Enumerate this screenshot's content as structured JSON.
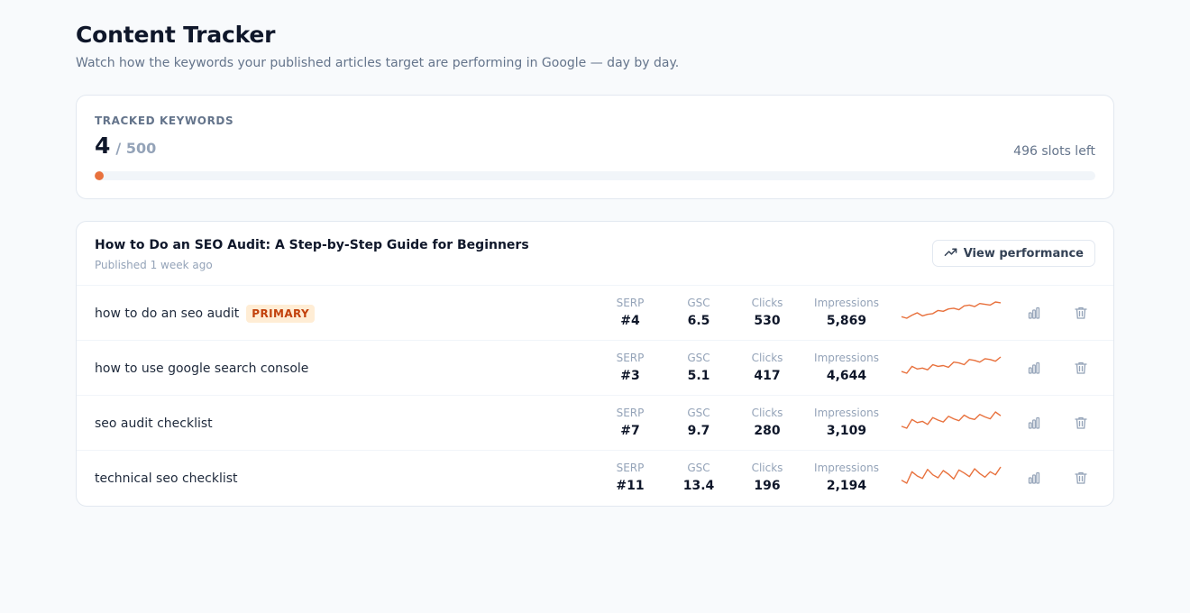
{
  "header": {
    "title": "Content Tracker",
    "subtitle": "Watch how the keywords your published articles target are performing in Google — day by day."
  },
  "quota": {
    "label": "TRACKED KEYWORDS",
    "used": "4",
    "total": "/ 500",
    "slots_left": "496 slots left",
    "fraction": 0.008
  },
  "article": {
    "title": "How to Do an SEO Audit: A Step-by-Step Guide for Beginners",
    "published": "Published 1 week ago",
    "view_performance_label": "View performance",
    "keywords": [
      {
        "keyword": "how to do an seo audit",
        "badge": "PRIMARY",
        "serp_label": "SERP",
        "serp": "#4",
        "gsc_label": "GSC",
        "gsc": "6.5",
        "clicks_label": "Clicks",
        "clicks": "530",
        "impressions_label": "Impressions",
        "impressions": "5,869",
        "trend": [
          6,
          6.2,
          5.8,
          5.5,
          5.9,
          5.7,
          5.6,
          5.2,
          5.3,
          5.0,
          4.9,
          5.1,
          4.6,
          4.5,
          4.7,
          4.3,
          4.4,
          4.5,
          4.1,
          4.2
        ]
      },
      {
        "keyword": "how to use google search console",
        "serp_label": "SERP",
        "serp": "#3",
        "gsc_label": "GSC",
        "gsc": "5.1",
        "clicks_label": "Clicks",
        "clicks": "417",
        "impressions_label": "Impressions",
        "impressions": "4,644",
        "trend": [
          6,
          6.2,
          5.4,
          5.7,
          5.6,
          5.8,
          5.2,
          5.4,
          5.3,
          5.5,
          4.9,
          5.0,
          5.2,
          4.6,
          4.7,
          4.9,
          4.5,
          4.6,
          4.8,
          4.3
        ]
      },
      {
        "keyword": "seo audit checklist",
        "serp_label": "SERP",
        "serp": "#7",
        "gsc_label": "GSC",
        "gsc": "9.7",
        "clicks_label": "Clicks",
        "clicks": "280",
        "impressions_label": "Impressions",
        "impressions": "3,109",
        "trend": [
          10.5,
          10.8,
          9.4,
          9.9,
          9.7,
          10.2,
          9.1,
          9.5,
          9.8,
          8.9,
          9.3,
          9.6,
          8.7,
          9.2,
          9.4,
          8.6,
          9.0,
          9.3,
          8.2,
          8.8
        ]
      },
      {
        "keyword": "technical seo checklist",
        "serp_label": "SERP",
        "serp": "#11",
        "gsc_label": "GSC",
        "gsc": "13.4",
        "clicks_label": "Clicks",
        "clicks": "196",
        "impressions_label": "Impressions",
        "impressions": "2,194",
        "trend": [
          14,
          14.5,
          12.6,
          13.3,
          13.7,
          12.2,
          13.1,
          13.6,
          12.4,
          13.0,
          13.8,
          12.3,
          12.8,
          13.4,
          12.1,
          12.9,
          13.5,
          12.6,
          13.1,
          11.8
        ]
      }
    ]
  },
  "colors": {
    "accent": "#e8713d",
    "badge_bg": "#ffedd5",
    "badge_text": "#c2410c",
    "icon": "#94a3b8"
  },
  "icons": {
    "view_performance": "trending-up-icon",
    "row_chart": "bar-chart-icon",
    "row_delete": "trash-icon"
  }
}
